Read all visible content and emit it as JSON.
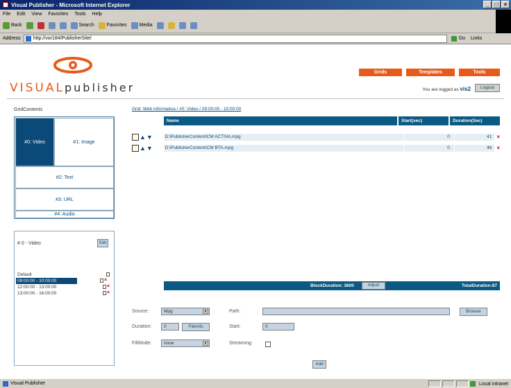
{
  "window": {
    "title": "Visual Publisher - Microsoft Internet Explorer"
  },
  "menu": [
    "File",
    "Edit",
    "View",
    "Favorites",
    "Tools",
    "Help"
  ],
  "toolbar": {
    "back": "Back",
    "search": "Search",
    "favorites": "Favorites",
    "media": "Media"
  },
  "address": {
    "label": "Address",
    "url": "http://vor184/PublisherSite/",
    "go": "Go",
    "links": "Links"
  },
  "brand": {
    "part1": "VISUAL",
    "part2": "publisher"
  },
  "nav": {
    "grids": "Grids",
    "templates": "Templates",
    "tools": "Tools"
  },
  "login": {
    "prefix": "You are logged as",
    "user": "vis2",
    "logout": "Logout"
  },
  "grid": {
    "title": "GridContents",
    "tiles": {
      "video": "#0: Video",
      "image": "#1: Image",
      "text": "#2: Text",
      "url": "#3: URL",
      "audio": "#4: Audio"
    }
  },
  "block": {
    "title": "# 0 - Video",
    "edit": "Edit",
    "schedule": [
      {
        "label": "Default",
        "selected": false
      },
      {
        "label": "09:00:00 - 10:00:00",
        "selected": true
      },
      {
        "label": "12:00:00 - 13:00:00",
        "selected": false
      },
      {
        "label": "13:00:00 - 16:00:00",
        "selected": false
      }
    ]
  },
  "breadcrumb": "Grid: Web informativa / #0: Video / 09:00:00 - 10:00:00",
  "table": {
    "headers": {
      "name": "Name",
      "start": "Start(sec)",
      "duration": "Duration(Sec)"
    },
    "rows": [
      {
        "path": "D:\\PublisherContent\\CM ACTIVA.mpg",
        "start": "0",
        "duration": "41"
      },
      {
        "path": "D:\\PublisherContent\\CM BTA.mpg",
        "start": "0",
        "duration": "46"
      }
    ]
  },
  "totals": {
    "block_duration": "BlockDuration: 3600",
    "adjust": "Adjust",
    "total_duration": "TotalDuration:87"
  },
  "form": {
    "source_label": "Source:",
    "source_value": "Mpg",
    "path_label": "Path:",
    "browse": "Browse",
    "duration_label": "Duration:",
    "duration_value": "0",
    "fileinfo": "FileInfo",
    "start_label": "Start:",
    "start_value": "0",
    "fillmode_label": "FillMode:",
    "fillmode_value": "none",
    "streaming_label": "Streaming:",
    "add": "Add"
  },
  "status": {
    "left": "Visual Publisher",
    "right": "Local intranet"
  },
  "colors": {
    "accent": "#e65a1a",
    "header_blue": "#0b5a84",
    "selected_blue": "#0b4a78"
  }
}
